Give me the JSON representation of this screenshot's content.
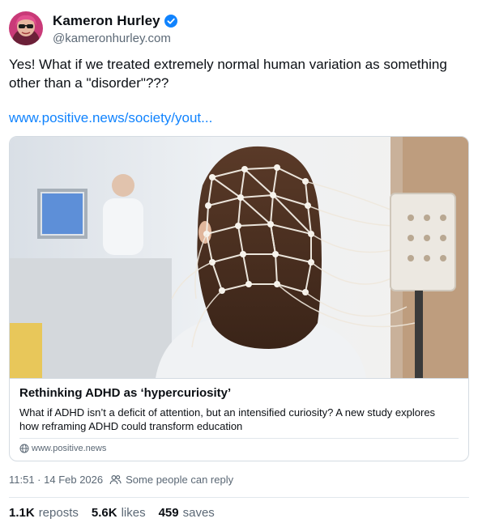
{
  "author": {
    "name": "Kameron Hurley",
    "handle": "@kameronhurley.com",
    "verified": true,
    "verified_icon": "verified-check-icon"
  },
  "post": {
    "text": "Yes! What if we treated extremely normal human variation as something other than a \"disorder\"???",
    "link": "www.positive.news/society/yout..."
  },
  "embed": {
    "title": "Rethinking ADHD as ‘hypercuriosity’",
    "description": "What if ADHD isn’t a deficit of attention, but an intensified curiosity? A new study explores how reframing ADHD could transform education",
    "domain": "www.positive.news",
    "domain_icon": "globe-icon"
  },
  "meta": {
    "timestamp": "11:51 · 14 Feb 2026",
    "reply_setting": "Some people can reply",
    "reply_icon": "people-icon"
  },
  "stats": {
    "reposts_count": "1.1K",
    "reposts_label": "reposts",
    "likes_count": "5.6K",
    "likes_label": "likes",
    "saves_count": "459",
    "saves_label": "saves"
  },
  "colors": {
    "link": "#1083fe",
    "verified": "#1083fe",
    "muted_text": "#5b6875",
    "border": "#d4dbe2"
  }
}
